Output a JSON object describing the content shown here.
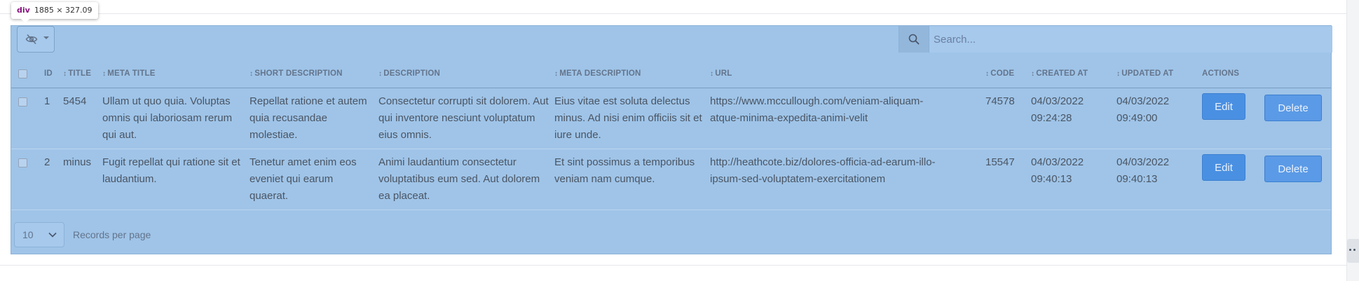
{
  "devtools": {
    "tag": "div",
    "dims": "1885 × 327.09"
  },
  "toolbar": {
    "columns_toggle_icon": "eye-slash-icon",
    "search": {
      "placeholder": "Search...",
      "value": "",
      "icon": "search-icon"
    }
  },
  "table": {
    "headers": {
      "id": "ID",
      "title": "TITLE",
      "meta_title": "META TITLE",
      "short_description": "SHORT DESCRIPTION",
      "description": "DESCRIPTION",
      "meta_description": "META DESCRIPTION",
      "url": "URL",
      "code": "CODE",
      "created_at": "CREATED AT",
      "updated_at": "UPDATED AT",
      "actions": "ACTIONS"
    },
    "rows": [
      {
        "id": "1",
        "title": "5454",
        "meta_title": "Ullam ut quo quia. Voluptas omnis qui laboriosam rerum qui aut.",
        "short_description": "Repellat ratione et autem quia recusandae molestiae.",
        "description": "Consectetur corrupti sit dolorem. Aut qui inventore nesciunt voluptatum eius omnis.",
        "meta_description": "Eius vitae est soluta delectus minus. Ad nisi enim officiis sit et iure unde.",
        "url": "https://www.mccullough.com/veniam-aliquam-atque-minima-expedita-animi-velit",
        "code": "74578",
        "created_at": "04/03/2022 09:24:28",
        "updated_at": "04/03/2022 09:49:00",
        "edit_label": "Edit",
        "delete_label": "Delete"
      },
      {
        "id": "2",
        "title": "minus",
        "meta_title": "Fugit repellat qui ratione sit et laudantium.",
        "short_description": "Tenetur amet enim eos eveniet qui earum quaerat.",
        "description": "Animi laudantium consectetur voluptatibus eum sed. Aut dolorem ea placeat.",
        "meta_description": "Et sint possimus a temporibus veniam nam cumque.",
        "url": "http://heathcote.biz/dolores-officia-ad-earum-illo-ipsum-sed-voluptatem-exercitationem",
        "code": "15547",
        "created_at": "04/03/2022 09:40:13",
        "updated_at": "04/03/2022 09:40:13",
        "edit_label": "Edit",
        "delete_label": "Delete"
      }
    ]
  },
  "pagination": {
    "per_page_value": "10",
    "per_page_label": "Records per page"
  },
  "colors": {
    "panel_bg": "#9fc4e8",
    "button_bg": "#4a90e2"
  }
}
